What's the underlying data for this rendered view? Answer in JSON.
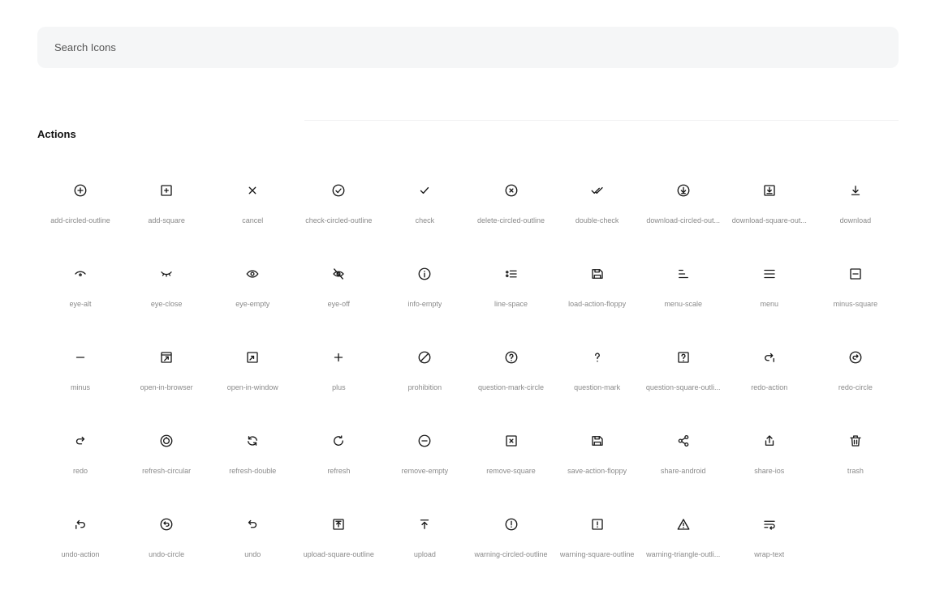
{
  "search": {
    "placeholder": "Search Icons",
    "value": ""
  },
  "section": {
    "title": "Actions"
  },
  "icons": [
    {
      "label": "add-circled-outline",
      "icon": "add-circled-outline-icon"
    },
    {
      "label": "add-square",
      "icon": "add-square-icon"
    },
    {
      "label": "cancel",
      "icon": "cancel-icon"
    },
    {
      "label": "check-circled-outline",
      "icon": "check-circled-outline-icon"
    },
    {
      "label": "check",
      "icon": "check-icon"
    },
    {
      "label": "delete-circled-outline",
      "icon": "delete-circled-outline-icon"
    },
    {
      "label": "double-check",
      "icon": "double-check-icon"
    },
    {
      "label": "download-circled-out...",
      "icon": "download-circled-outline-icon"
    },
    {
      "label": "download-square-out...",
      "icon": "download-square-outline-icon"
    },
    {
      "label": "download",
      "icon": "download-icon"
    },
    {
      "label": "eye-alt",
      "icon": "eye-alt-icon"
    },
    {
      "label": "eye-close",
      "icon": "eye-close-icon"
    },
    {
      "label": "eye-empty",
      "icon": "eye-empty-icon"
    },
    {
      "label": "eye-off",
      "icon": "eye-off-icon"
    },
    {
      "label": "info-empty",
      "icon": "info-empty-icon"
    },
    {
      "label": "line-space",
      "icon": "line-space-icon"
    },
    {
      "label": "load-action-floppy",
      "icon": "load-action-floppy-icon"
    },
    {
      "label": "menu-scale",
      "icon": "menu-scale-icon"
    },
    {
      "label": "menu",
      "icon": "menu-icon"
    },
    {
      "label": "minus-square",
      "icon": "minus-square-icon"
    },
    {
      "label": "minus",
      "icon": "minus-icon"
    },
    {
      "label": "open-in-browser",
      "icon": "open-in-browser-icon"
    },
    {
      "label": "open-in-window",
      "icon": "open-in-window-icon"
    },
    {
      "label": "plus",
      "icon": "plus-icon"
    },
    {
      "label": "prohibition",
      "icon": "prohibition-icon"
    },
    {
      "label": "question-mark-circle",
      "icon": "question-mark-circle-icon"
    },
    {
      "label": "question-mark",
      "icon": "question-mark-icon"
    },
    {
      "label": "question-square-outli...",
      "icon": "question-square-outline-icon"
    },
    {
      "label": "redo-action",
      "icon": "redo-action-icon"
    },
    {
      "label": "redo-circle",
      "icon": "redo-circle-icon"
    },
    {
      "label": "redo",
      "icon": "redo-icon"
    },
    {
      "label": "refresh-circular",
      "icon": "refresh-circular-icon"
    },
    {
      "label": "refresh-double",
      "icon": "refresh-double-icon"
    },
    {
      "label": "refresh",
      "icon": "refresh-icon"
    },
    {
      "label": "remove-empty",
      "icon": "remove-empty-icon"
    },
    {
      "label": "remove-square",
      "icon": "remove-square-icon"
    },
    {
      "label": "save-action-floppy",
      "icon": "save-action-floppy-icon"
    },
    {
      "label": "share-android",
      "icon": "share-android-icon"
    },
    {
      "label": "share-ios",
      "icon": "share-ios-icon"
    },
    {
      "label": "trash",
      "icon": "trash-icon"
    },
    {
      "label": "undo-action",
      "icon": "undo-action-icon"
    },
    {
      "label": "undo-circle",
      "icon": "undo-circle-icon"
    },
    {
      "label": "undo",
      "icon": "undo-icon"
    },
    {
      "label": "upload-square-outline",
      "icon": "upload-square-outline-icon"
    },
    {
      "label": "upload",
      "icon": "upload-icon"
    },
    {
      "label": "warning-circled-outline",
      "icon": "warning-circled-outline-icon"
    },
    {
      "label": "warning-square-outline",
      "icon": "warning-square-outline-icon"
    },
    {
      "label": "warning-triangle-outli...",
      "icon": "warning-triangle-outline-icon"
    },
    {
      "label": "wrap-text",
      "icon": "wrap-text-icon"
    }
  ]
}
